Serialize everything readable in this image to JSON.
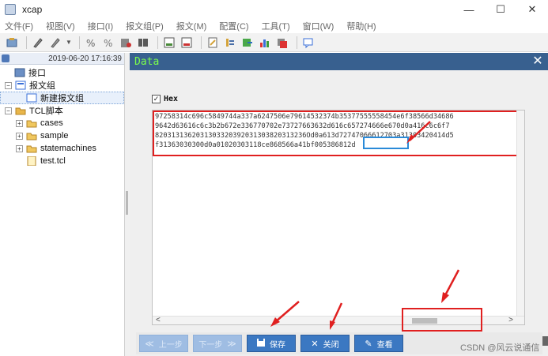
{
  "window": {
    "title": "xcap",
    "minimize": "—",
    "maximize": "☐",
    "close": "✕"
  },
  "menu": [
    "文件(F)",
    "视图(V)",
    "接口(I)",
    "报文组(P)",
    "报文(M)",
    "配置(C)",
    "工具(T)",
    "窗口(W)",
    "帮助(H)"
  ],
  "toolbar": {
    "faded_text": "some_faded_label"
  },
  "tree": {
    "header_date": "2019-06-20 17:16:39",
    "items": [
      {
        "label": "接口",
        "indent": 0,
        "expander": "",
        "icon": "interface-icon"
      },
      {
        "label": "报文组",
        "indent": 0,
        "expander": "⊟",
        "icon": "message-group-icon"
      },
      {
        "label": "新建报文组",
        "indent": 1,
        "expander": "",
        "icon": "new-group-icon",
        "selected": true
      },
      {
        "label": "TCL脚本",
        "indent": 0,
        "expander": "⊟",
        "icon": "tcl-script-icon"
      },
      {
        "label": "cases",
        "indent": 1,
        "expander": "⊞",
        "icon": "folder-icon"
      },
      {
        "label": "sample",
        "indent": 1,
        "expander": "⊞",
        "icon": "folder-icon"
      },
      {
        "label": "statemachines",
        "indent": 1,
        "expander": "⊞",
        "icon": "folder-icon"
      },
      {
        "label": "test.tcl",
        "indent": 1,
        "expander": "",
        "icon": "file-icon"
      }
    ]
  },
  "data_panel": {
    "title": "Data",
    "close": "✕",
    "hex_checkbox_label": "Hex",
    "hex_checked": true,
    "hex_lines": [
      "97258314c696c5849744a337a6247506e79614532374b35377555558454e6f38566d34686",
      "9642d63616c6c3b2b672e336770702e73727663632d616c657274666e670d0a416c6c6f7",
      "8203131362031303320392031303820313236Od0a613d72747066612703a31303420414d5",
      "f31363030300d0a01020303118ce868566a41bf005386812d"
    ],
    "scroll_left": "<",
    "scroll_right": ">"
  },
  "buttons": {
    "prev": {
      "label": "上一步",
      "glyph": "≪"
    },
    "next": {
      "label": "下一步",
      "glyph": "≫"
    },
    "save": {
      "label": "保存",
      "glyph": "💾"
    },
    "close": {
      "label": "关闭",
      "glyph": "✕"
    },
    "view": {
      "label": "查看",
      "glyph": "✎"
    }
  },
  "watermark": "CSDN @风云说通信",
  "colors": {
    "accent": "#38608f",
    "title_green": "#7cff4b",
    "highlight_red": "#e02020",
    "highlight_blue": "#2a8ad8",
    "button_blue": "#3b78c2"
  }
}
